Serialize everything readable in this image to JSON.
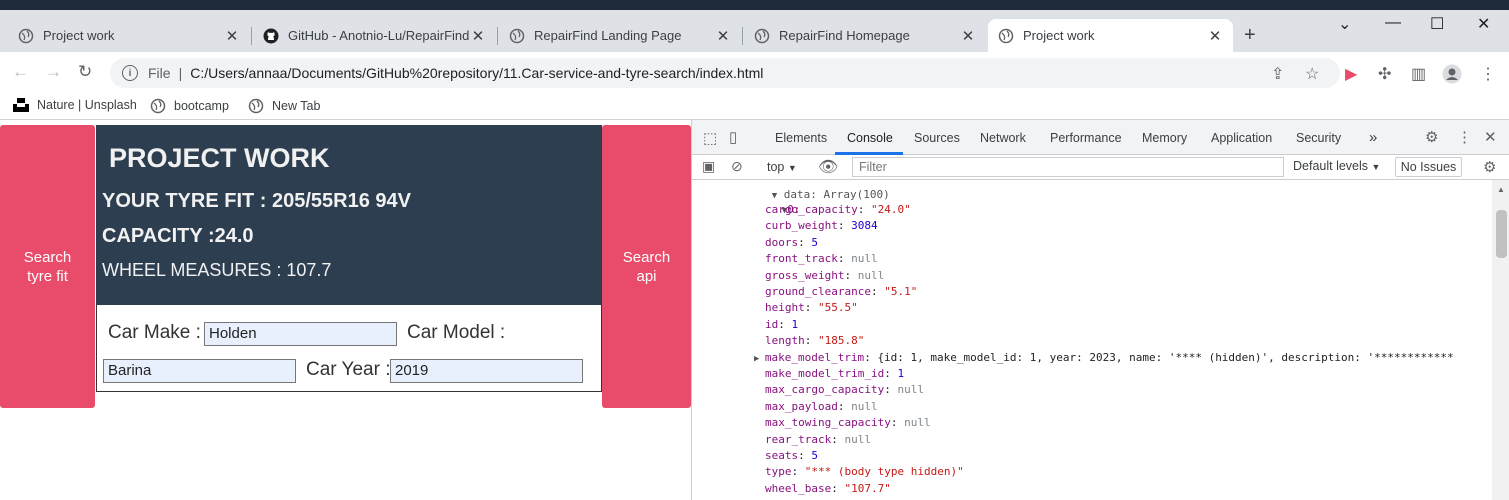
{
  "browser": {
    "tabs": [
      {
        "title": "Project work",
        "icon": "globe-icon",
        "active": false
      },
      {
        "title": "GitHub - Anotnio-Lu/RepairFind:",
        "icon": "github-icon",
        "active": false
      },
      {
        "title": "RepairFind Landing Page",
        "icon": "globe-icon",
        "active": false
      },
      {
        "title": "RepairFind Homepage",
        "icon": "globe-icon",
        "active": false
      },
      {
        "title": "Project work",
        "icon": "globe-icon",
        "active": true
      }
    ],
    "address": {
      "scheme": "File",
      "url": "C:/Users/annaa/Documents/GitHub%20repository/11.Car-service-and-tyre-search/index.html"
    },
    "bookmarks": [
      {
        "label": "Nature | Unsplash",
        "icon": "unsplash-icon"
      },
      {
        "label": "bootcamp",
        "icon": "globe-icon"
      },
      {
        "label": "New Tab",
        "icon": "globe-icon"
      }
    ]
  },
  "page": {
    "search_tyre_button": "Search tyre fit",
    "search_api_button": "Search api",
    "title": "PROJECT WORK",
    "tyre_fit": "YOUR TYRE FIT : 205/55R16 94V",
    "capacity": "CAPACITY :24.0",
    "wheel_measures": "WHEEL MEASURES : 107.7",
    "form": {
      "make_label": "Car Make :",
      "make_value": "Holden",
      "model_label": "Car Model :",
      "model_value": "Barina",
      "year_label": "Car Year :",
      "year_value": "2019"
    }
  },
  "devtools": {
    "tabs": [
      "Elements",
      "Console",
      "Sources",
      "Network",
      "Performance",
      "Memory",
      "Application",
      "Security"
    ],
    "active_tab": "Console",
    "more_tabs": "»",
    "context": "top",
    "filter_placeholder": "Filter",
    "levels": "Default levels",
    "issues": "No Issues",
    "console_header": "data: Array(100)",
    "index_label": "0:",
    "properties": [
      {
        "key": "cargo_capacity",
        "value": "\"24.0\"",
        "kind": "string"
      },
      {
        "key": "curb_weight",
        "value": "3084",
        "kind": "number"
      },
      {
        "key": "doors",
        "value": "5",
        "kind": "number"
      },
      {
        "key": "front_track",
        "value": "null",
        "kind": "null"
      },
      {
        "key": "gross_weight",
        "value": "null",
        "kind": "null"
      },
      {
        "key": "ground_clearance",
        "value": "\"5.1\"",
        "kind": "string"
      },
      {
        "key": "height",
        "value": "\"55.5\"",
        "kind": "string"
      },
      {
        "key": "id",
        "value": "1",
        "kind": "number"
      },
      {
        "key": "length",
        "value": "\"185.8\"",
        "kind": "string"
      },
      {
        "key": "make_model_trim",
        "value": "{id: 1, make_model_id: 1, year: 2023, name: '**** (hidden)', description: '************",
        "kind": "object"
      },
      {
        "key": "make_model_trim_id",
        "value": "1",
        "kind": "number"
      },
      {
        "key": "max_cargo_capacity",
        "value": "null",
        "kind": "null"
      },
      {
        "key": "max_payload",
        "value": "null",
        "kind": "null"
      },
      {
        "key": "max_towing_capacity",
        "value": "null",
        "kind": "null"
      },
      {
        "key": "rear_track",
        "value": "null",
        "kind": "null"
      },
      {
        "key": "seats",
        "value": "5",
        "kind": "number"
      },
      {
        "key": "type",
        "value": "\"*** (body type hidden)\"",
        "kind": "string"
      },
      {
        "key": "wheel_base",
        "value": "\"107.7\"",
        "kind": "string"
      }
    ]
  }
}
